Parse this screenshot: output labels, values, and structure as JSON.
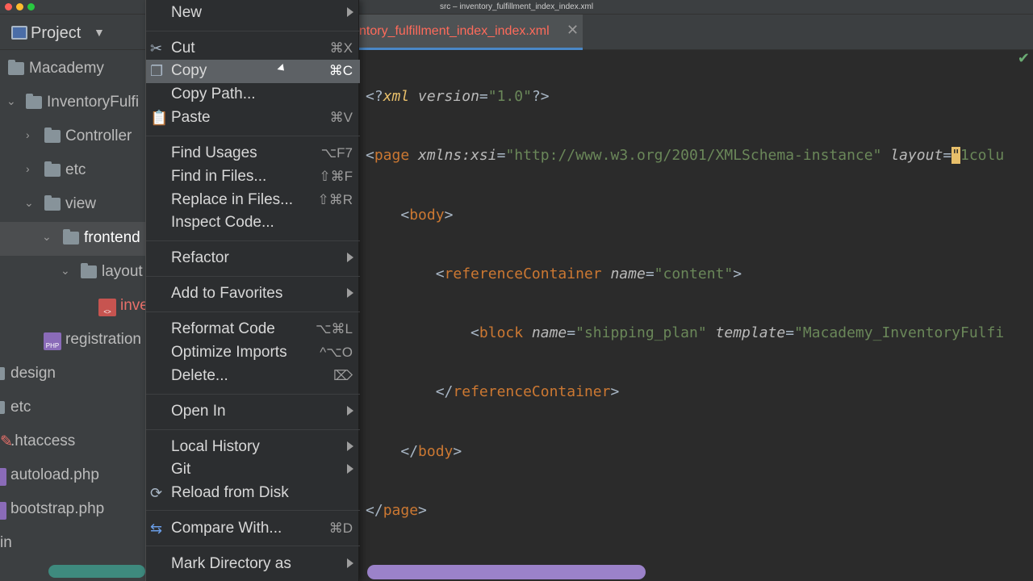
{
  "window": {
    "title": "src – inventory_fulfillment_index_index.xml"
  },
  "project_panel": {
    "title": "Project",
    "tree": [
      {
        "label": "Macademy"
      },
      {
        "label": "InventoryFulfi"
      },
      {
        "label": "Controller"
      },
      {
        "label": "etc"
      },
      {
        "label": "view"
      },
      {
        "label": "frontend"
      },
      {
        "label": "layout"
      },
      {
        "label": "inve"
      },
      {
        "label": "registration"
      },
      {
        "label": "design"
      },
      {
        "label": "etc"
      },
      {
        "label": ".htaccess"
      },
      {
        "label": "autoload.php"
      },
      {
        "label": "bootstrap.php"
      },
      {
        "label": "in"
      }
    ],
    "badges": {
      "xml": "<>",
      "php": "PHP"
    }
  },
  "editor": {
    "tab_label": "ntory_fulfillment_index_index.xml",
    "code": {
      "l1": {
        "open": "<?",
        "tag": "xml",
        "attr": "version",
        "eq": "=",
        "val": "\"1.0\"",
        "close": "?>"
      },
      "l2": {
        "open": "<",
        "tag": "page",
        "attr1": "xmlns:",
        "attr1b": "xsi",
        "eq1": "=",
        "val1": "\"http://www.w3.org/2001/XMLSchema-instance\"",
        "attr2": "layout",
        "eq2": "=",
        "val2a": "\"",
        "val2b": "1colu"
      },
      "l3": {
        "open": "<",
        "tag": "body",
        "close": ">"
      },
      "l4": {
        "open": "<",
        "tag": "referenceContainer",
        "attr": "name",
        "eq": "=",
        "val": "\"content\"",
        "close": ">"
      },
      "l5": {
        "open": "<",
        "tag": "block",
        "attr1": "name",
        "eq1": "=",
        "val1": "\"shipping_plan\"",
        "attr2": "template",
        "eq2": "=",
        "val2": "\"Macademy_InventoryFulfi"
      },
      "l6": {
        "open": "</",
        "tag": "referenceContainer",
        "close": ">"
      },
      "l7": {
        "open": "</",
        "tag": "body",
        "close": ">"
      },
      "l8": {
        "open": "</",
        "tag": "page",
        "close": ">"
      }
    }
  },
  "context_menu": {
    "items": {
      "new": {
        "label": "New"
      },
      "cut": {
        "label": "Cut",
        "shortcut": "⌘X"
      },
      "copy": {
        "label": "Copy",
        "shortcut": "⌘C"
      },
      "copy_path": {
        "label": "Copy Path..."
      },
      "paste": {
        "label": "Paste",
        "shortcut": "⌘V"
      },
      "find_usages": {
        "label": "Find Usages",
        "shortcut": "⌥F7"
      },
      "find_in_files": {
        "label": "Find in Files...",
        "shortcut": "⇧⌘F"
      },
      "replace_in_files": {
        "label": "Replace in Files...",
        "shortcut": "⇧⌘R"
      },
      "inspect_code": {
        "label": "Inspect Code..."
      },
      "refactor": {
        "label": "Refactor"
      },
      "add_to_favorites": {
        "label": "Add to Favorites"
      },
      "reformat_code": {
        "label": "Reformat Code",
        "shortcut": "⌥⌘L"
      },
      "optimize_imports": {
        "label": "Optimize Imports",
        "shortcut": "^⌥O"
      },
      "delete": {
        "label": "Delete...",
        "shortcut": "⌦"
      },
      "open_in": {
        "label": "Open In"
      },
      "local_history": {
        "label": "Local History"
      },
      "git": {
        "label": "Git"
      },
      "reload_from_disk": {
        "label": "Reload from Disk"
      },
      "compare_with": {
        "label": "Compare With...",
        "shortcut": "⌘D"
      },
      "mark_directory_as": {
        "label": "Mark Directory as"
      }
    }
  }
}
